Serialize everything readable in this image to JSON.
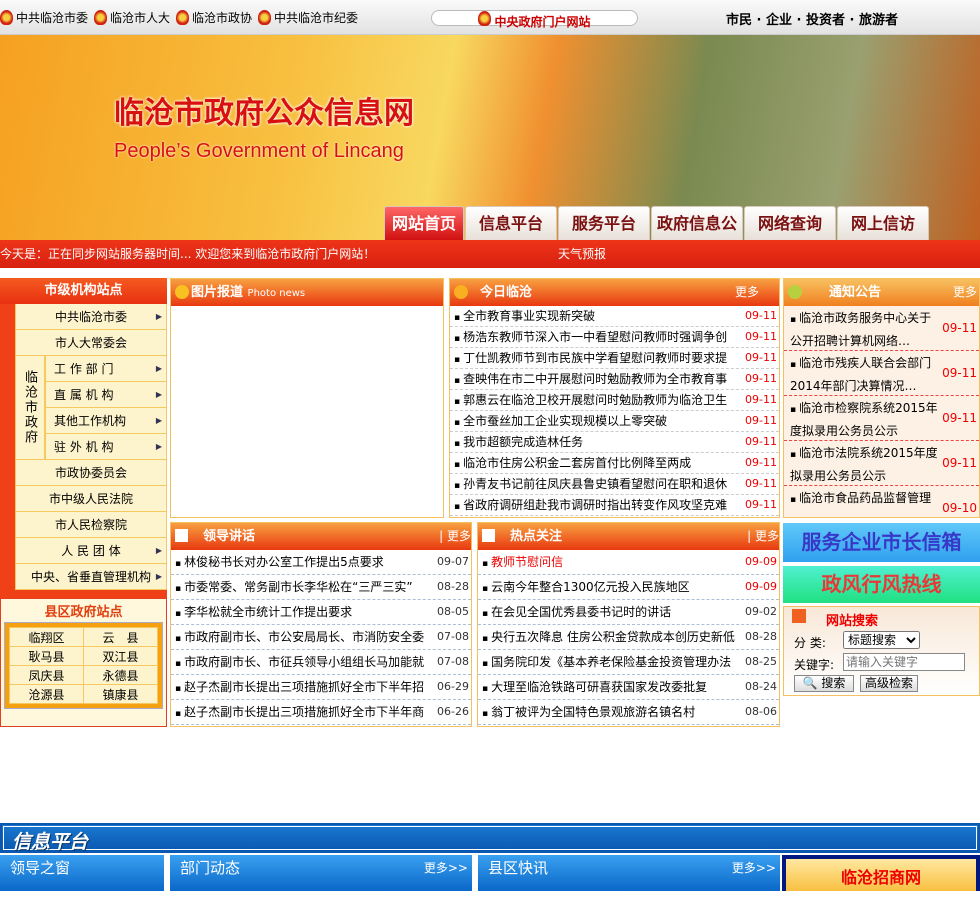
{
  "topbar": {
    "links": [
      "中共临沧市委",
      "临沧市人大",
      "临沧市政协",
      "中共临沧市纪委"
    ],
    "portal": "中央政府门户网站",
    "slogan": "市民 · 企业 · 投资者 · 旅游者"
  },
  "banner": {
    "title": "临沧市政府公众信息网",
    "subtitle": "People’s Government of Lincang"
  },
  "tabs": [
    "网站首页",
    "信息平台",
    "服务平台",
    "政府信息公开",
    "网络查询",
    "网上信访"
  ],
  "marquee": {
    "text": "今天是：正在同步网站服务器时间... 欢迎您来到临沧市政府门户网站！",
    "weather": "天气预报"
  },
  "left": {
    "title": "市级机构站点",
    "items_top": [
      {
        "label": "中共临沧市委",
        "arrow": true
      },
      {
        "label": "市人大常委会",
        "arrow": false
      }
    ],
    "gov_label": "临沧市政府",
    "gov_items": [
      "工 作 部 门",
      "直 属 机 构",
      "其他工作机构",
      "驻 外 机 构"
    ],
    "items_bottom": [
      {
        "label": "市政协委员会",
        "arrow": false
      },
      {
        "label": "市中级人民法院",
        "arrow": false
      },
      {
        "label": "市人民检察院",
        "arrow": false
      },
      {
        "label": "人 民 团 体",
        "arrow": true
      },
      {
        "label": "中央、省垂直管理机构",
        "arrow": true
      }
    ],
    "county_title": "县区政府站点",
    "counties": [
      [
        "临翔区",
        "云　县"
      ],
      [
        "耿马县",
        "双江县"
      ],
      [
        "凤庆县",
        "永德县"
      ],
      [
        "沧源县",
        "镇康县"
      ]
    ]
  },
  "photo": {
    "title": "图片报道",
    "subtitle": "Photo news"
  },
  "today": {
    "title": "今日临沧",
    "more": "更多",
    "items": [
      {
        "t": "全市教育事业实现新突破",
        "d": "09-11"
      },
      {
        "t": "杨浩东教师节深入市一中看望慰问教师时强调争创",
        "d": "09-11"
      },
      {
        "t": "丁仕凯教师节到市民族中学看望慰问教师时要求提",
        "d": "09-11"
      },
      {
        "t": "查映伟在市二中开展慰问时勉励教师为全市教育事",
        "d": "09-11"
      },
      {
        "t": "郭惠云在临沧卫校开展慰问时勉励教师为临沧卫生",
        "d": "09-11"
      },
      {
        "t": "全市蚕丝加工企业实现规模以上零突破",
        "d": "09-11"
      },
      {
        "t": "我市超额完成造林任务",
        "d": "09-11"
      },
      {
        "t": "临沧市住房公积金二套房首付比例降至两成",
        "d": "09-11"
      },
      {
        "t": "孙青友书记前往凤庆县鲁史镇看望慰问在职和退休",
        "d": "09-11"
      },
      {
        "t": "省政府调研组赴我市调研时指出转变作风攻坚克难",
        "d": "09-11"
      }
    ]
  },
  "notice": {
    "title": "通知公告",
    "more": "更多",
    "items": [
      {
        "t": "临沧市政务服务中心关于公开招聘计算机网络…",
        "d": "09-11"
      },
      {
        "t": "临沧市残疾人联合会部门2014年部门决算情况…",
        "d": "09-11"
      },
      {
        "t": "临沧市检察院系统2015年度拟录用公务员公示",
        "d": "09-11"
      },
      {
        "t": "临沧市法院系统2015年度拟录用公务员公示",
        "d": "09-11"
      },
      {
        "t": "临沧市食品药品监督管理",
        "d": "09-10"
      }
    ]
  },
  "side_banners": [
    "服务企业市长信箱",
    "政风行风热线"
  ],
  "search": {
    "title": "网站搜索",
    "category_label": "分 类:",
    "category_value": "标题搜索",
    "keyword_label": "关键字:",
    "keyword_placeholder": "请输入关键字",
    "search_btn": "搜索",
    "advanced_btn": "高级检索"
  },
  "speech": {
    "title": "领导讲话",
    "more": "更多",
    "items": [
      {
        "t": "林俊秘书长对办公室工作提出5点要求",
        "d": "09-07"
      },
      {
        "t": "市委常委、常务副市长李华松在“三严三实”",
        "d": "08-28"
      },
      {
        "t": "李华松就全市统计工作提出要求",
        "d": "08-05"
      },
      {
        "t": "市政府副市长、市公安局局长、市消防安全委",
        "d": "07-08"
      },
      {
        "t": "市政府副市长、市征兵领导小组组长马加能就",
        "d": "07-08"
      },
      {
        "t": "赵子杰副市长提出三项措施抓好全市下半年招",
        "d": "06-29"
      },
      {
        "t": "赵子杰副市长提出三项措施抓好全市下半年商",
        "d": "06-26"
      }
    ]
  },
  "hot": {
    "title": "热点关注",
    "more": "更多",
    "items": [
      {
        "t": "教师节慰问信",
        "d": "09-09",
        "red": true
      },
      {
        "t": "云南今年整合1300亿元投入民族地区",
        "d": "09-09",
        "dred": true
      },
      {
        "t": "在会见全国优秀县委书记时的讲话",
        "d": "09-02"
      },
      {
        "t": "央行五次降息  住房公积金贷款成本创历史新低",
        "d": "08-28"
      },
      {
        "t": "国务院印发《基本养老保险基金投资管理办法",
        "d": "08-25"
      },
      {
        "t": "大理至临沧铁路可研喜获国家发改委批复",
        "d": "08-24"
      },
      {
        "t": "翁丁被评为全国特色景观旅游名镇名村",
        "d": "08-06"
      }
    ]
  },
  "info": {
    "title": "信息平台",
    "sections": [
      {
        "title": "领导之窗"
      },
      {
        "title": "部门动态",
        "more": "更多>>"
      },
      {
        "title": "县区快讯",
        "more": "更多>>"
      }
    ],
    "ad": "临沧招商网"
  }
}
